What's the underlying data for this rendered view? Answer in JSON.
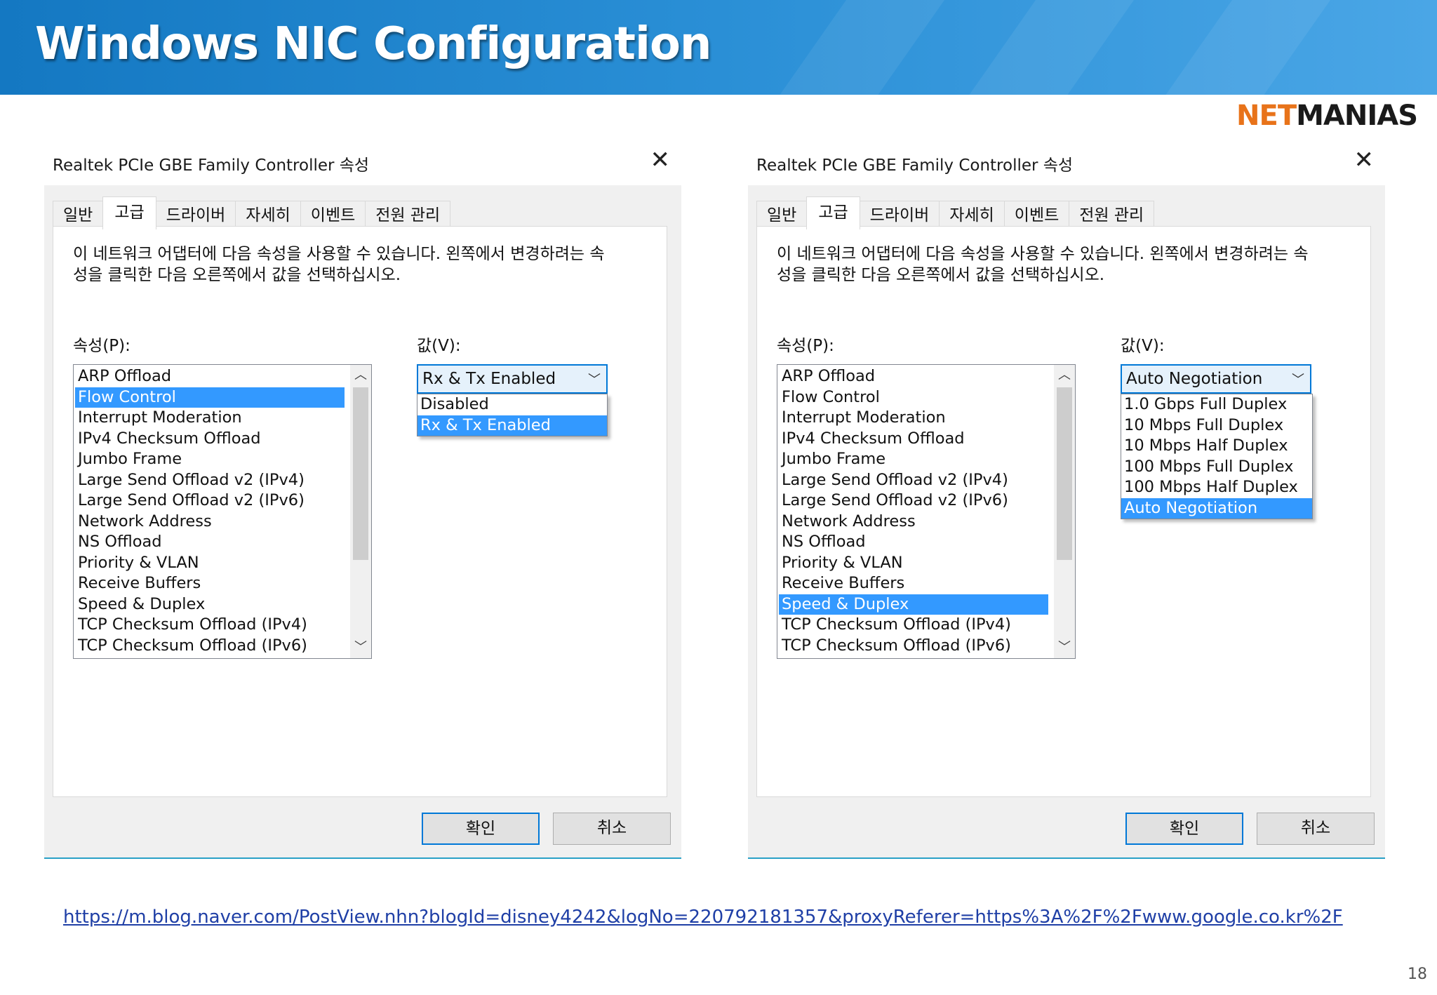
{
  "slide": {
    "title": "Windows NIC Configuration",
    "logo_part1": "NET",
    "logo_part2": "MANIAS",
    "source_url": "https://m.blog.naver.com/PostView.nhn?blogId=disney4242&logNo=220792181357&proxyReferer=https%3A%2F%2Fwww.google.co.kr%2F",
    "page_number": "18"
  },
  "colors": {
    "header_blue": "#1478c2",
    "selection_blue": "#3399ff",
    "focus_blue": "#0078d7",
    "logo_orange": "#e8731a"
  },
  "dialogs": [
    {
      "title": "Realtek PCIe GBE Family Controller 속성",
      "close_icon": "close-icon",
      "tabs": [
        "일반",
        "고급",
        "드라이버",
        "자세히",
        "이벤트",
        "전원 관리"
      ],
      "active_tab": "고급",
      "description": "이 네트워크 어댑터에 다음 속성을 사용할 수 있습니다. 왼쪽에서 변경하려는 속성을 클릭한 다음 오른쪽에서 값을 선택하십시오.",
      "property_label": "속성(P):",
      "value_label": "값(V):",
      "properties": [
        "ARP Offload",
        "Flow Control",
        "Interrupt Moderation",
        "IPv4 Checksum Offload",
        "Jumbo Frame",
        "Large Send Offload v2 (IPv4)",
        "Large Send Offload v2 (IPv6)",
        "Network Address",
        "NS Offload",
        "Priority & VLAN",
        "Receive Buffers",
        "Speed & Duplex",
        "TCP Checksum Offload (IPv4)",
        "TCP Checksum Offload (IPv6)"
      ],
      "selected_property": "Flow Control",
      "value_selected": "Rx & Tx Enabled",
      "value_options": [
        "Disabled",
        "Rx & Tx Enabled"
      ],
      "ok_label": "확인",
      "cancel_label": "취소"
    },
    {
      "title": "Realtek PCIe GBE Family Controller 속성",
      "close_icon": "close-icon",
      "tabs": [
        "일반",
        "고급",
        "드라이버",
        "자세히",
        "이벤트",
        "전원 관리"
      ],
      "active_tab": "고급",
      "description": "이 네트워크 어댑터에 다음 속성을 사용할 수 있습니다. 왼쪽에서 변경하려는 속성을 클릭한 다음 오른쪽에서 값을 선택하십시오.",
      "property_label": "속성(P):",
      "value_label": "값(V):",
      "properties": [
        "ARP Offload",
        "Flow Control",
        "Interrupt Moderation",
        "IPv4 Checksum Offload",
        "Jumbo Frame",
        "Large Send Offload v2 (IPv4)",
        "Large Send Offload v2 (IPv6)",
        "Network Address",
        "NS Offload",
        "Priority & VLAN",
        "Receive Buffers",
        "Speed & Duplex",
        "TCP Checksum Offload (IPv4)",
        "TCP Checksum Offload (IPv6)"
      ],
      "selected_property": "Speed & Duplex",
      "value_selected": "Auto Negotiation",
      "value_options": [
        "1.0 Gbps Full Duplex",
        "10 Mbps Full Duplex",
        "10 Mbps Half Duplex",
        "100 Mbps Full Duplex",
        "100 Mbps Half Duplex",
        "Auto Negotiation"
      ],
      "ok_label": "확인",
      "cancel_label": "취소"
    }
  ]
}
